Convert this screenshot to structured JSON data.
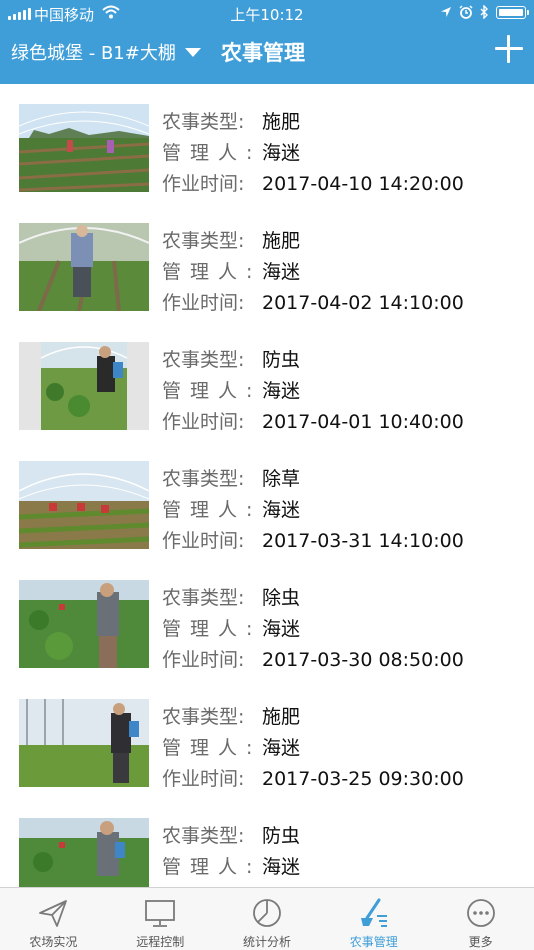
{
  "status_bar": {
    "carrier": "中国移动",
    "time": "上午10:12"
  },
  "header": {
    "farm_selector": "绿色城堡 - B1#大棚",
    "title": "农事管理"
  },
  "labels": {
    "type": "农事类型:",
    "manager": "管理人:",
    "time": "作业时间:"
  },
  "records": [
    {
      "type": "施肥",
      "manager": "海迷",
      "time": "2017-04-10 14:20:00"
    },
    {
      "type": "施肥",
      "manager": "海迷",
      "time": "2017-04-02 14:10:00"
    },
    {
      "type": "防虫",
      "manager": "海迷",
      "time": "2017-04-01 10:40:00"
    },
    {
      "type": "除草",
      "manager": "海迷",
      "time": "2017-03-31 14:10:00"
    },
    {
      "type": "除虫",
      "manager": "海迷",
      "time": "2017-03-30 08:50:00"
    },
    {
      "type": "施肥",
      "manager": "海迷",
      "time": "2017-03-25 09:30:00"
    },
    {
      "type": "防虫",
      "manager": "海迷",
      "time": ""
    }
  ],
  "tabs": [
    {
      "label": "农场实况",
      "icon": "paper-plane-icon",
      "active": false
    },
    {
      "label": "远程控制",
      "icon": "monitor-icon",
      "active": false
    },
    {
      "label": "统计分析",
      "icon": "pie-chart-icon",
      "active": false
    },
    {
      "label": "农事管理",
      "icon": "farm-tool-icon",
      "active": true
    },
    {
      "label": "更多",
      "icon": "more-dots-icon",
      "active": false
    }
  ],
  "colors": {
    "brand": "#3f9ed8",
    "tab_inactive": "#7a7a7a"
  }
}
